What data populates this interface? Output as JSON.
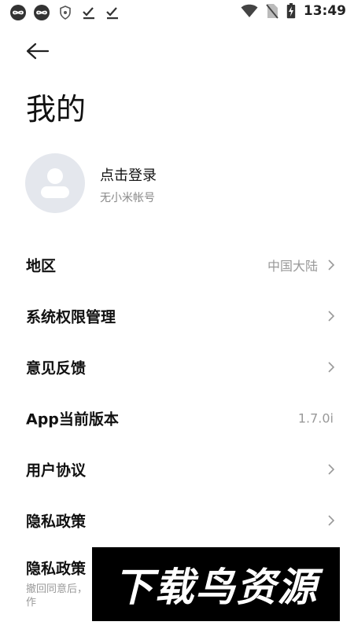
{
  "status_bar": {
    "time": "13:49",
    "left_icons": [
      "infinity-icon",
      "infinity-icon",
      "shield-icon",
      "check-download-icon",
      "check-download-icon"
    ],
    "right_icons": [
      "wifi-icon",
      "no-sim-icon",
      "battery-charging-icon"
    ]
  },
  "page": {
    "title": "我的"
  },
  "profile": {
    "login_text": "点击登录",
    "account_text": "无小米帐号"
  },
  "menu": [
    {
      "label": "地区",
      "value": "中国大陆",
      "arrow": true
    },
    {
      "label": "系统权限管理",
      "value": "",
      "arrow": true
    },
    {
      "label": "意见反馈",
      "value": "",
      "arrow": true
    },
    {
      "label": "App当前版本",
      "value": "1.7.0i",
      "arrow": false
    },
    {
      "label": "用户协议",
      "value": "",
      "arrow": true
    },
    {
      "label": "隐私政策",
      "value": "",
      "arrow": true
    },
    {
      "label": "隐私政策",
      "sublabel": "撤回同意后，作",
      "arrow": false
    }
  ],
  "watermark": {
    "text": "下载鸟资源"
  }
}
